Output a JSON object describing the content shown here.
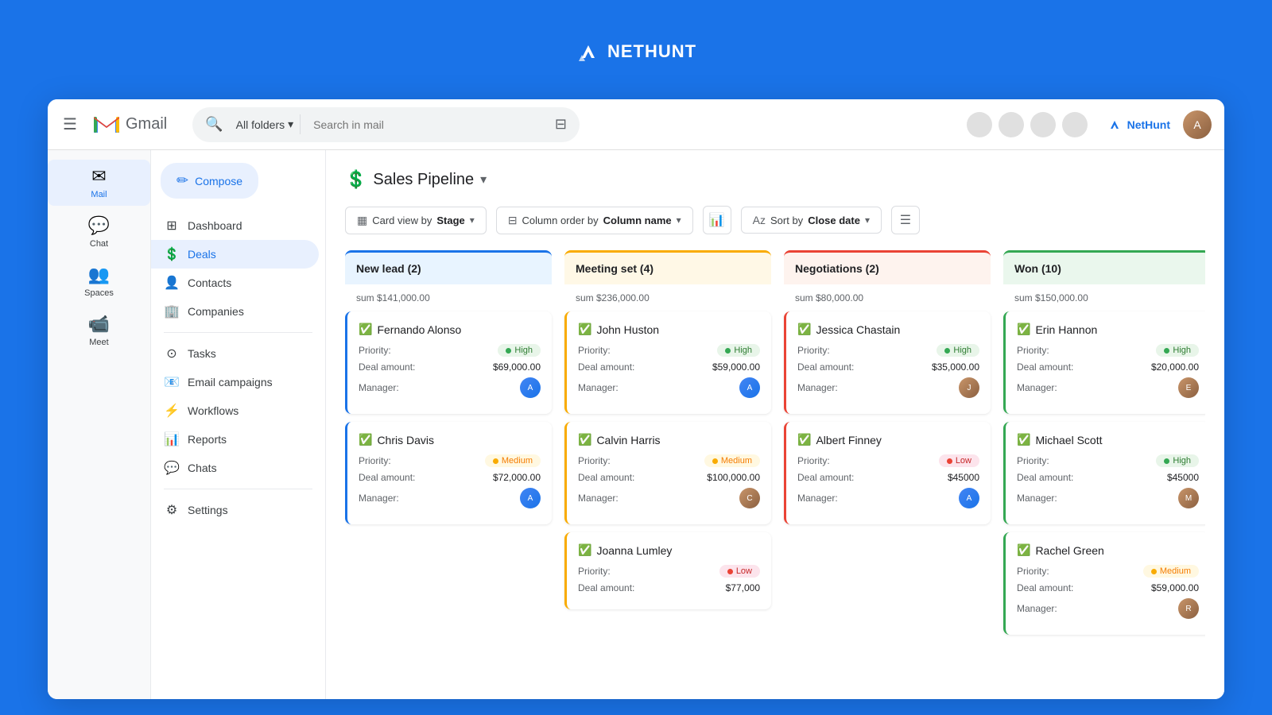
{
  "top_banner": {
    "logo_text": "NETHUNT"
  },
  "gmail_header": {
    "logo_text": "Gmail",
    "search_placeholder": "Search in mail",
    "folder_label": "All folders",
    "nethunt_label": "NetHunt"
  },
  "sidebar": {
    "items": [
      {
        "id": "mail",
        "label": "Mail",
        "icon": "✉"
      },
      {
        "id": "chat",
        "label": "Chat",
        "icon": "💬"
      },
      {
        "id": "spaces",
        "label": "Spaces",
        "icon": "👥"
      },
      {
        "id": "meet",
        "label": "Meet",
        "icon": "📹"
      }
    ],
    "active": "mail"
  },
  "nav": {
    "compose_label": "Compose",
    "items": [
      {
        "id": "dashboard",
        "label": "Dashboard",
        "icon": "⊞"
      },
      {
        "id": "deals",
        "label": "Deals",
        "icon": "💲",
        "active": true
      },
      {
        "id": "contacts",
        "label": "Contacts",
        "icon": "👤"
      },
      {
        "id": "companies",
        "label": "Companies",
        "icon": "🏢"
      },
      {
        "id": "tasks",
        "label": "Tasks",
        "icon": "⊙"
      },
      {
        "id": "email-campaigns",
        "label": "Email campaigns",
        "icon": "📧"
      },
      {
        "id": "workflows",
        "label": "Workflows",
        "icon": "⚡"
      },
      {
        "id": "reports",
        "label": "Reports",
        "icon": "📊"
      },
      {
        "id": "chats",
        "label": "Chats",
        "icon": "💬"
      },
      {
        "id": "settings",
        "label": "Settings",
        "icon": "⚙"
      }
    ]
  },
  "pipeline": {
    "title": "Sales Pipeline",
    "toolbar": {
      "card_view_label": "Card view by",
      "card_view_value": "Stage",
      "column_order_label": "Column order by",
      "column_order_value": "Column name",
      "sort_label": "Sort by",
      "sort_value": "Close date"
    },
    "columns": [
      {
        "id": "new-lead",
        "title": "New lead",
        "count": 2,
        "type": "new-lead",
        "sum": "sum $141,000.00",
        "deals": [
          {
            "name": "Fernando Alonso",
            "priority": "High",
            "priority_type": "high",
            "deal_amount": "$69,000.00",
            "manager_type": "blue"
          },
          {
            "name": "Chris Davis",
            "priority": "Medium",
            "priority_type": "medium",
            "deal_amount": "$72,000.00",
            "manager_type": "blue"
          }
        ]
      },
      {
        "id": "meeting-set",
        "title": "Meeting set",
        "count": 4,
        "type": "meeting-set",
        "sum": "sum $236,000.00",
        "deals": [
          {
            "name": "John Huston",
            "priority": "High",
            "priority_type": "high",
            "deal_amount": "$59,000.00",
            "manager_type": "blue"
          },
          {
            "name": "Calvin Harris",
            "priority": "Medium",
            "priority_type": "medium",
            "deal_amount": "$100,000.00",
            "manager_type": "orange"
          },
          {
            "name": "Joanna Lumley",
            "priority": "Low",
            "priority_type": "low",
            "deal_amount": "$77,000",
            "manager_type": "blue"
          }
        ]
      },
      {
        "id": "negotiations",
        "title": "Negotiations",
        "count": 2,
        "type": "negotiations",
        "sum": "sum $80,000.00",
        "deals": [
          {
            "name": "Jessica Chastain",
            "priority": "High",
            "priority_type": "high",
            "deal_amount": "$35,000.00",
            "manager_type": "orange"
          },
          {
            "name": "Albert Finney",
            "priority": "Low",
            "priority_type": "low",
            "deal_amount": "$45000",
            "manager_type": "blue"
          }
        ]
      },
      {
        "id": "won",
        "title": "Won",
        "count": 10,
        "type": "won",
        "sum": "sum $150,000.00",
        "deals": [
          {
            "name": "Erin Hannon",
            "priority": "High",
            "priority_type": "high",
            "deal_amount": "$20,000.00",
            "manager_type": "orange"
          },
          {
            "name": "Michael Scott",
            "priority": "High",
            "priority_type": "high",
            "deal_amount": "$45000",
            "manager_type": "orange"
          },
          {
            "name": "Rachel Green",
            "priority": "Medium",
            "priority_type": "medium",
            "deal_amount": "$59,000.00",
            "manager_type": "orange"
          }
        ]
      }
    ]
  }
}
